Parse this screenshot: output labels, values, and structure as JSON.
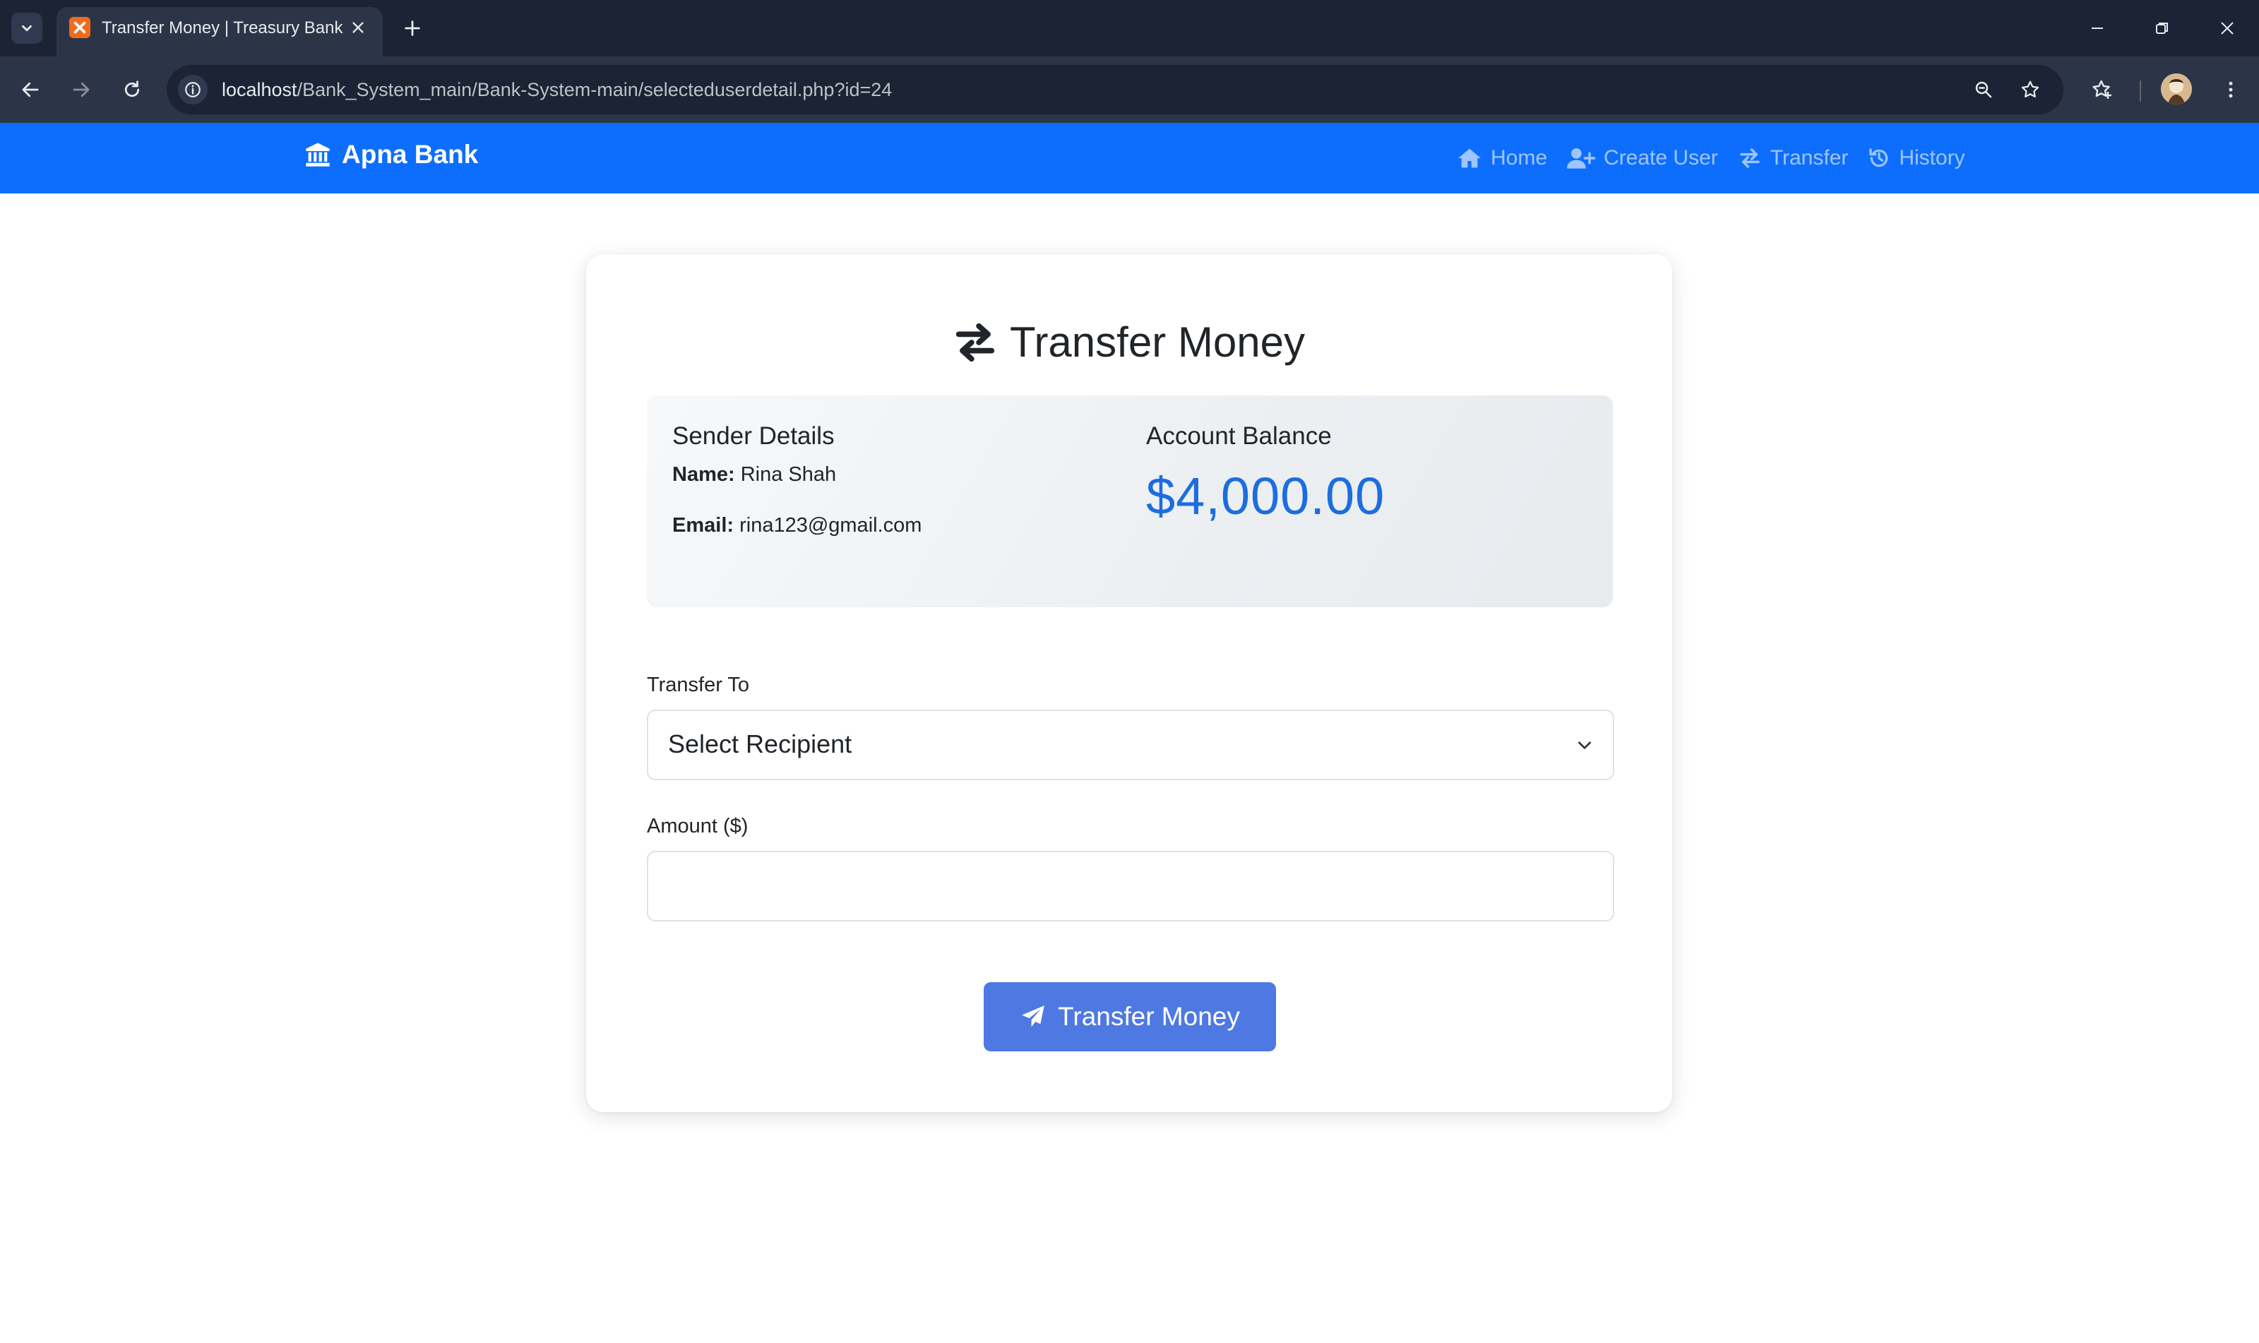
{
  "browser": {
    "tab_title": "Transfer Money | Treasury Bank",
    "url_host": "localhost",
    "url_path": "/Bank_System_main/Bank-System-main/selecteduserdetail.php?id=24"
  },
  "navbar": {
    "brand": "Apna Bank",
    "links": [
      {
        "label": "Home",
        "icon": "home-icon"
      },
      {
        "label": "Create User",
        "icon": "user-plus-icon"
      },
      {
        "label": "Transfer",
        "icon": "exchange-icon"
      },
      {
        "label": "History",
        "icon": "history-icon"
      }
    ],
    "bg_color": "#0d6efd"
  },
  "card": {
    "title": "Transfer Money",
    "sender": {
      "heading": "Sender Details",
      "name_label": "Name:",
      "name": "Rina Shah",
      "email_label": "Email:",
      "email": "rina123@gmail.com"
    },
    "balance": {
      "heading": "Account Balance",
      "amount": "$4,000.00",
      "color": "#1c6de0"
    },
    "form": {
      "transfer_to_label": "Transfer To",
      "recipient_selected": "Select Recipient",
      "amount_label": "Amount ($)",
      "amount_value": ""
    },
    "submit_label": "Transfer Money",
    "submit_color": "#4f79e2"
  }
}
